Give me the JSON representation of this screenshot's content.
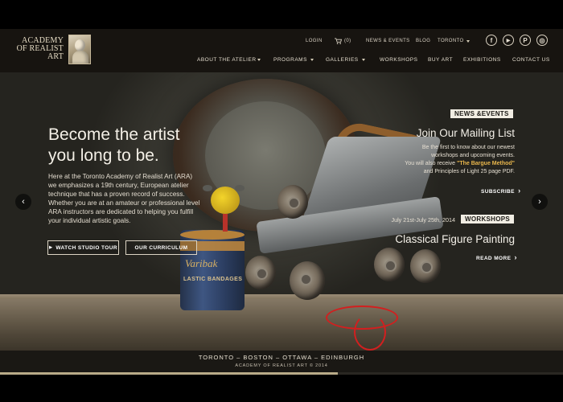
{
  "brand": {
    "logo_lines": [
      "ACADEMY",
      "OF REALIST",
      "ART"
    ]
  },
  "utility_nav": {
    "login": "LOGIN",
    "cart_count": "(0)",
    "news_events": "NEWS & EVENTS",
    "blog": "BLOG",
    "location": "TORONTO"
  },
  "socials": {
    "facebook": "f",
    "youtube": "▶",
    "pinterest": "P",
    "instagram": "◎"
  },
  "main_nav": {
    "about": "ABOUT THE ATELIER",
    "programs": "PROGRAMS",
    "galleries": "GALLERIES",
    "workshops": "WORKSHOPS",
    "buy_art": "BUY ART",
    "exhibitions": "EXHIBITIONS",
    "contact": "CONTACT US"
  },
  "hero": {
    "headline_line1": "Become the artist",
    "headline_line2": "you long to be.",
    "intro": "Here at the Toronto Academy of Realist Art (ARA) we emphasizes a 19th century, European atelier technique that has a proven record of success. Whether you are at an amateur or professional level ARA instructors are dedicated to helping you fulfill your individual artistic goals.",
    "watch_btn": "WATCH STUDIO TOUR",
    "watch_icon": "▶",
    "curriculum_btn": "OUR CURRICULUM",
    "tin_brand": "Varibak",
    "tin_text": "LASTIC BANDAGES",
    "prev_arrow": "‹",
    "next_arrow": "›"
  },
  "news": {
    "tag": "NEWS &EVENTS",
    "title": "Join Our Mailing List",
    "line1": "Be the first to know about our newest",
    "line2": "workshops and upcoming events.",
    "line3_pre": "You will also receive ",
    "line3_gold": "\"The Bargue Method\"",
    "line4": "and Principles of Light 25 page PDF.",
    "link": "SUBSCRIBE",
    "chevron": "›"
  },
  "workshop": {
    "date": "July 21st-July 25th, 2014",
    "tag": "WORKSHOPS",
    "title": "Classical Figure Painting",
    "link": "READ MORE",
    "chevron": "›"
  },
  "footer": {
    "cities": "TORONTO – BOSTON – OTTAWA – EDINBURGH",
    "copyright": "ACADEMY OF REALIST ART © 2014"
  },
  "slider": {
    "progress": 0.6
  },
  "colors": {
    "accent_gold": "#e8b64c",
    "header_bg": "#171410"
  }
}
